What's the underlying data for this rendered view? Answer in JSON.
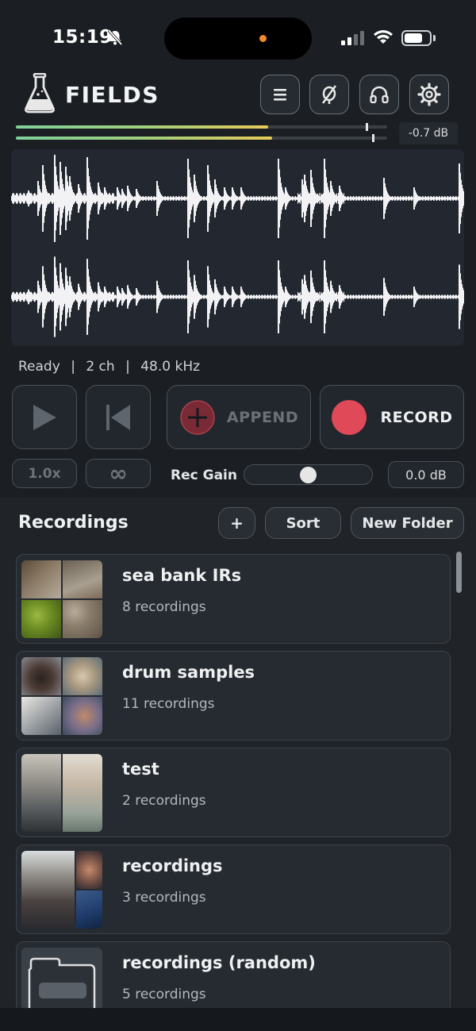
{
  "status_bar": {
    "time": "15:19"
  },
  "header": {
    "app_title": "FIELDS",
    "icons": [
      "menu-icon",
      "input-monitor-off-icon",
      "headphones-icon",
      "settings-gear-icon"
    ]
  },
  "meters": {
    "left_level": 0.68,
    "right_level": 0.69,
    "peak_db": "-0.7 dB"
  },
  "info": {
    "status": "Ready",
    "channels": "2 ch",
    "sample_rate": "48.0 kHz",
    "separator": "|"
  },
  "transport": {
    "append_label": "APPEND",
    "record_label": "RECORD",
    "speed_label": "1.0x",
    "loop_symbol": "∞",
    "rec_gain_label": "Rec Gain",
    "rec_gain_value": "0.0 dB",
    "rec_gain_level": 0.5
  },
  "recordings": {
    "title": "Recordings",
    "add_label": "+",
    "sort_label": "Sort",
    "new_folder_label": "New Folder",
    "folders": [
      {
        "name": "sea bank IRs",
        "count": "8 recordings"
      },
      {
        "name": "drum samples",
        "count": "11 recordings"
      },
      {
        "name": "test",
        "count": "2 recordings"
      },
      {
        "name": "recordings",
        "count": "3 recordings"
      },
      {
        "name": "recordings (random)",
        "count": "5 recordings"
      }
    ]
  },
  "colors": {
    "background": "#1b1f24",
    "record_red": "#e04a58",
    "append_red": "#7a2a35",
    "meter_green": "#7ed09a",
    "meter_yellow": "#e8c958"
  }
}
